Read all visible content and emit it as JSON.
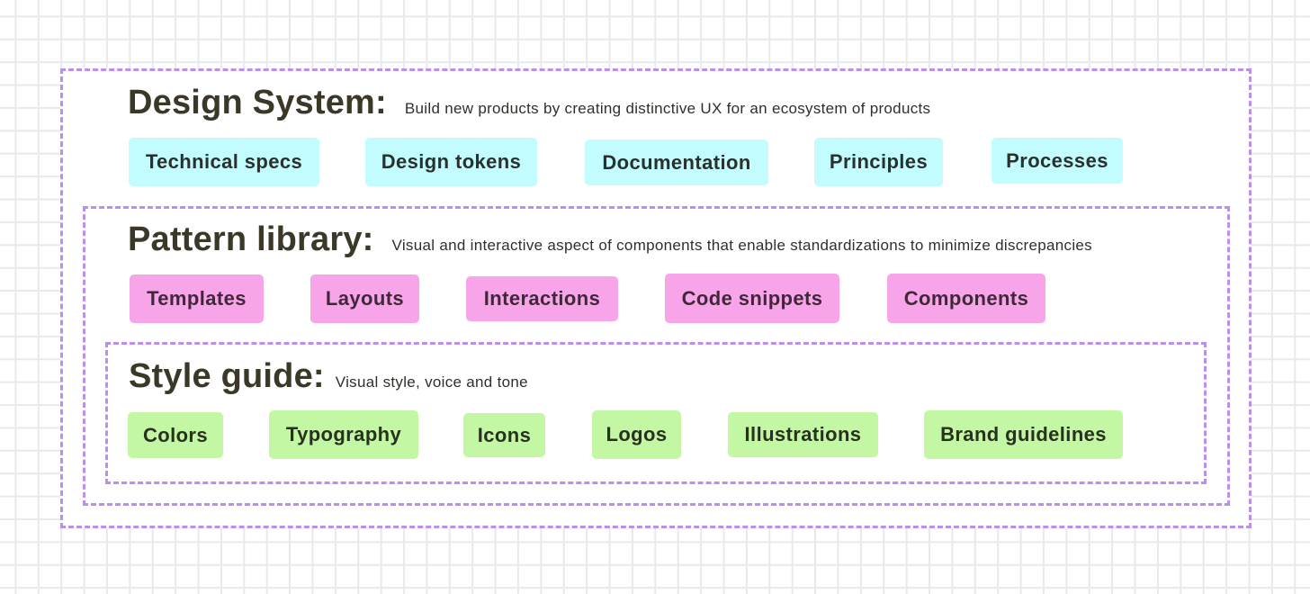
{
  "colors": {
    "border_dashed": "#b98ff0",
    "grid_line": "#e9e9e9",
    "text_dark": "#3b3828",
    "design_system_chip": "#c2fcff",
    "pattern_library_chip": "#f8a4e9",
    "style_guide_chip": "#c3f7a3"
  },
  "design_system": {
    "title": "Design System:",
    "description": "Build new products by creating distinctive UX for an ecosystem of products",
    "items": [
      "Technical specs",
      "Design tokens",
      "Documentation",
      "Principles",
      "Processes"
    ]
  },
  "pattern_library": {
    "title": "Pattern library:",
    "description": "Visual and interactive aspect of components that enable standardizations to minimize discrepancies",
    "items": [
      "Templates",
      "Layouts",
      "Interactions",
      "Code snippets",
      "Components"
    ]
  },
  "style_guide": {
    "title": "Style guide:",
    "description": "Visual style, voice and tone",
    "items": [
      "Colors",
      "Typography",
      "Icons",
      "Logos",
      "Illustrations",
      "Brand guidelines"
    ]
  }
}
